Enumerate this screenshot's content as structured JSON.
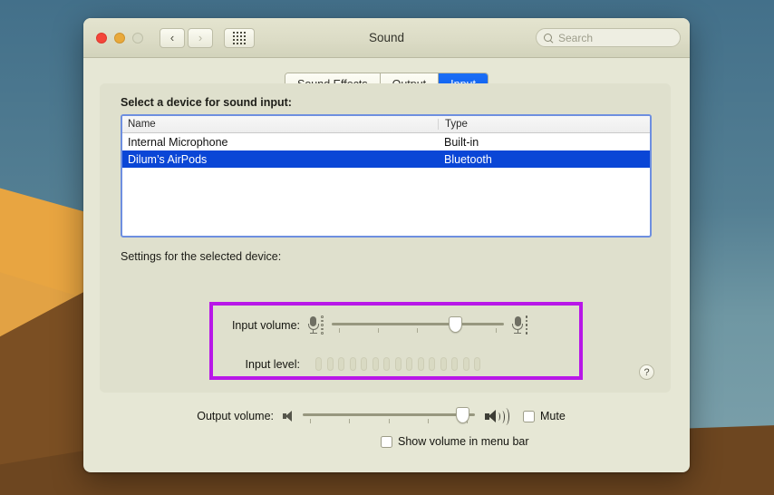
{
  "desktop": {
    "wallpaper_name": "desert-dunes-wallpaper"
  },
  "window": {
    "title": "Sound",
    "traffic_lights": {
      "close": "close-button",
      "minimize": "minimize-button",
      "zoom": "zoom-button"
    },
    "nav": {
      "back": "‹",
      "forward": "›",
      "grid": "show-all-grid-button"
    },
    "search": {
      "placeholder": "Search",
      "value": ""
    }
  },
  "tabs": [
    {
      "label": "Sound Effects",
      "active": false
    },
    {
      "label": "Output",
      "active": false
    },
    {
      "label": "Input",
      "active": true
    }
  ],
  "device_section": {
    "label": "Select a device for sound input:",
    "columns": [
      "Name",
      "Type"
    ],
    "rows": [
      {
        "name": "Internal Microphone",
        "type": "Built-in",
        "selected": false
      },
      {
        "name": "Dilum’s AirPods",
        "type": "Bluetooth",
        "selected": true
      }
    ]
  },
  "settings_section": {
    "label": "Settings for the selected device:",
    "input_volume": {
      "label": "Input volume:",
      "value_percent": 72,
      "tick_count": 5
    },
    "input_level": {
      "label": "Input level:",
      "segment_count": 15,
      "lit_segments": 0
    },
    "annotation": {
      "name": "highlight-box",
      "color": "#b817e8"
    }
  },
  "output_section": {
    "label": "Output volume:",
    "value_percent": 93,
    "tick_count": 5,
    "mute": {
      "label": "Mute",
      "checked": false
    },
    "show_in_menu_bar": {
      "label": "Show volume in menu bar",
      "checked": false
    }
  },
  "help": {
    "label": "?"
  },
  "colors": {
    "accent_blue": "#0a46d6",
    "tab_blue": "#0a5ff0",
    "highlight_magenta": "#b817e8",
    "window_bg": "#e6e7d5",
    "panel_bg": "#dfe0cd"
  }
}
